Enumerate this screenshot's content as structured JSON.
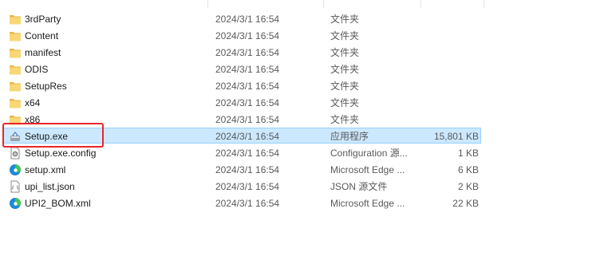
{
  "files": [
    {
      "name": "3rdParty",
      "date": "2024/3/1 16:54",
      "type": "文件夹",
      "size": "",
      "icon": "folder-icon"
    },
    {
      "name": "Content",
      "date": "2024/3/1 16:54",
      "type": "文件夹",
      "size": "",
      "icon": "folder-icon"
    },
    {
      "name": "manifest",
      "date": "2024/3/1 16:54",
      "type": "文件夹",
      "size": "",
      "icon": "folder-icon"
    },
    {
      "name": "ODIS",
      "date": "2024/3/1 16:54",
      "type": "文件夹",
      "size": "",
      "icon": "folder-icon"
    },
    {
      "name": "SetupRes",
      "date": "2024/3/1 16:54",
      "type": "文件夹",
      "size": "",
      "icon": "folder-icon"
    },
    {
      "name": "x64",
      "date": "2024/3/1 16:54",
      "type": "文件夹",
      "size": "",
      "icon": "folder-icon"
    },
    {
      "name": "x86",
      "date": "2024/3/1 16:54",
      "type": "文件夹",
      "size": "",
      "icon": "folder-icon"
    },
    {
      "name": "Setup.exe",
      "date": "2024/3/1 16:54",
      "type": "应用程序",
      "size": "15,801 KB",
      "icon": "installer-icon"
    },
    {
      "name": "Setup.exe.config",
      "date": "2024/3/1 16:54",
      "type": "Configuration 源...",
      "size": "1 KB",
      "icon": "config-file-icon"
    },
    {
      "name": "setup.xml",
      "date": "2024/3/1 16:54",
      "type": "Microsoft Edge ...",
      "size": "6 KB",
      "icon": "edge-icon"
    },
    {
      "name": "upi_list.json",
      "date": "2024/3/1 16:54",
      "type": "JSON 源文件",
      "size": "2 KB",
      "icon": "json-file-icon"
    },
    {
      "name": "UPI2_BOM.xml",
      "date": "2024/3/1 16:54",
      "type": "Microsoft Edge ...",
      "size": "22 KB",
      "icon": "edge-icon"
    }
  ],
  "selected_index": 7,
  "colors": {
    "selection_bg": "#cce8ff",
    "selection_border": "#99d1ff",
    "highlight_box": "#e8262b",
    "folder": "#f8d775"
  }
}
